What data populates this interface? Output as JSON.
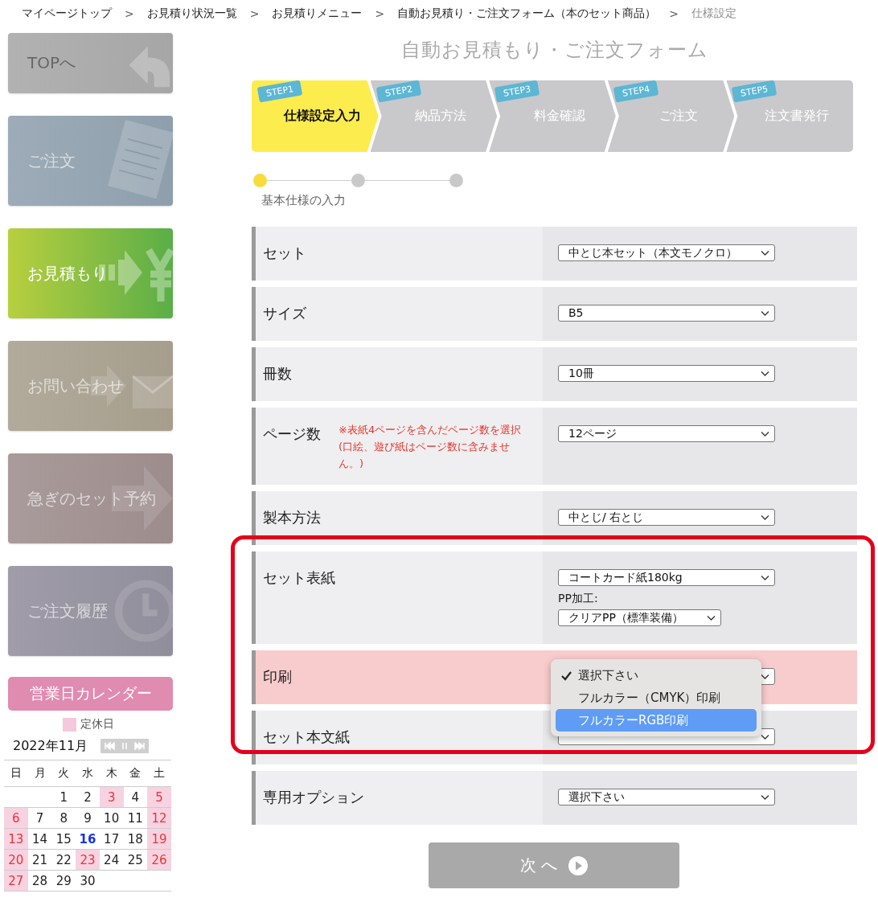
{
  "breadcrumb": {
    "separator": ">",
    "items": [
      {
        "label": "マイページトップ",
        "current": false
      },
      {
        "label": "お見積り状況一覧",
        "current": false
      },
      {
        "label": "お見積りメニュー",
        "current": false
      },
      {
        "label": "自動お見積り・ご注文フォーム（本のセット商品）",
        "current": false
      },
      {
        "label": "仕様設定",
        "current": true
      }
    ]
  },
  "sidebar": {
    "items": [
      {
        "label": "TOPへ",
        "color": "#a6a6a6",
        "selected": false
      },
      {
        "label": "ご注文",
        "color": "#8aa0b0",
        "selected": false
      },
      {
        "label": "お見積もり",
        "color": "#5aae48",
        "selected": true
      },
      {
        "label": "お問い合わせ",
        "color": "#a89e88",
        "selected": false
      },
      {
        "label": "急ぎのセット予約",
        "color": "#a08b8b",
        "selected": false
      },
      {
        "label": "ご注文履歴",
        "color": "#918e9f",
        "selected": false
      }
    ]
  },
  "calendar": {
    "button": "営業日カレンダー",
    "legend": "定休日",
    "month": "2022年11月",
    "weekdays": [
      "日",
      "月",
      "火",
      "水",
      "木",
      "金",
      "土"
    ],
    "weeks": [
      [
        {
          "day": "1",
          "holiday": false,
          "today": false
        },
        {
          "day": "2",
          "holiday": false,
          "today": false
        },
        {
          "day": "3",
          "holiday": true,
          "today": false
        },
        {
          "day": "4",
          "holiday": false,
          "today": false
        },
        {
          "day": "5",
          "holiday": true,
          "today": false
        }
      ],
      [
        {
          "day": "6",
          "holiday": true,
          "today": false
        },
        {
          "day": "7",
          "holiday": false,
          "today": false
        },
        {
          "day": "8",
          "holiday": false,
          "today": false
        },
        {
          "day": "9",
          "holiday": false,
          "today": false
        },
        {
          "day": "10",
          "holiday": false,
          "today": false
        },
        {
          "day": "11",
          "holiday": false,
          "today": false
        },
        {
          "day": "12",
          "holiday": true,
          "today": false
        }
      ],
      [
        {
          "day": "13",
          "holiday": true,
          "today": false
        },
        {
          "day": "14",
          "holiday": false,
          "today": false
        },
        {
          "day": "15",
          "holiday": false,
          "today": false
        },
        {
          "day": "16",
          "holiday": false,
          "today": true
        },
        {
          "day": "17",
          "holiday": false,
          "today": false
        },
        {
          "day": "18",
          "holiday": false,
          "today": false
        },
        {
          "day": "19",
          "holiday": true,
          "today": false
        }
      ],
      [
        {
          "day": "20",
          "holiday": true,
          "today": false
        },
        {
          "day": "21",
          "holiday": false,
          "today": false
        },
        {
          "day": "22",
          "holiday": false,
          "today": false
        },
        {
          "day": "23",
          "holiday": true,
          "today": false
        },
        {
          "day": "24",
          "holiday": false,
          "today": false
        },
        {
          "day": "25",
          "holiday": false,
          "today": false
        },
        {
          "day": "26",
          "holiday": true,
          "today": false
        }
      ],
      [
        {
          "day": "27",
          "holiday": true,
          "today": false
        },
        {
          "day": "28",
          "holiday": false,
          "today": false
        },
        {
          "day": "29",
          "holiday": false,
          "today": false
        },
        {
          "day": "30",
          "holiday": false,
          "today": false
        }
      ]
    ]
  },
  "form": {
    "title": "自動お見積もり・ご注文フォーム",
    "steps": [
      {
        "tag": "STEP1",
        "label": "仕様設定入力",
        "selected": true
      },
      {
        "tag": "STEP2",
        "label": "納品方法",
        "selected": false
      },
      {
        "tag": "STEP3",
        "label": "料金確認",
        "selected": false
      },
      {
        "tag": "STEP4",
        "label": "ご注文",
        "selected": false
      },
      {
        "tag": "STEP5",
        "label": "注文書発行",
        "selected": false
      }
    ],
    "progress": {
      "dots": [
        {
          "selected": true
        },
        {
          "selected": false
        },
        {
          "selected": false
        }
      ],
      "label": "基本仕様の入力"
    },
    "rows": [
      {
        "label": "セット",
        "highlighted": false,
        "controls": [
          {
            "kind": "select",
            "value": "中とじ本セット（本文モノクロ）"
          }
        ]
      },
      {
        "label": "サイズ",
        "highlighted": false,
        "controls": [
          {
            "kind": "select",
            "value": "B5"
          }
        ]
      },
      {
        "label": "冊数",
        "highlighted": false,
        "controls": [
          {
            "kind": "select",
            "value": "10冊"
          }
        ]
      },
      {
        "label": "ページ数",
        "note": "※表紙4ページを含んだページ数を選択(口絵、遊び紙はページ数に含みません。)",
        "highlighted": false,
        "controls": [
          {
            "kind": "select",
            "value": "12ページ"
          }
        ]
      },
      {
        "label": "製本方法",
        "highlighted": false,
        "controls": [
          {
            "kind": "select",
            "value": "中とじ/ 右とじ"
          }
        ]
      },
      {
        "label": "セット表紙",
        "highlighted": false,
        "controls": [
          {
            "kind": "select",
            "value": "コートカード紙180kg"
          },
          {
            "kind": "caption",
            "text": "PP加工:"
          },
          {
            "kind": "select",
            "value": "クリアPP（標準装備）"
          }
        ]
      },
      {
        "label": "印刷",
        "highlighted": true,
        "controls": [
          {
            "kind": "select",
            "open": true,
            "options": [
              {
                "label": "選択下さい",
                "checked": true,
                "highlighted": false
              },
              {
                "label": "フルカラー（CMYK）印刷",
                "checked": false,
                "highlighted": false
              },
              {
                "label": "フルカラーRGB印刷",
                "checked": false,
                "highlighted": true
              }
            ]
          }
        ]
      },
      {
        "label": "セット本文紙",
        "highlighted": false,
        "controls": [
          {
            "kind": "select"
          }
        ]
      },
      {
        "label": "専用オプション",
        "highlighted": false,
        "controls": [
          {
            "kind": "select",
            "value": "選択下さい"
          }
        ]
      }
    ],
    "next_button": "次 へ"
  }
}
